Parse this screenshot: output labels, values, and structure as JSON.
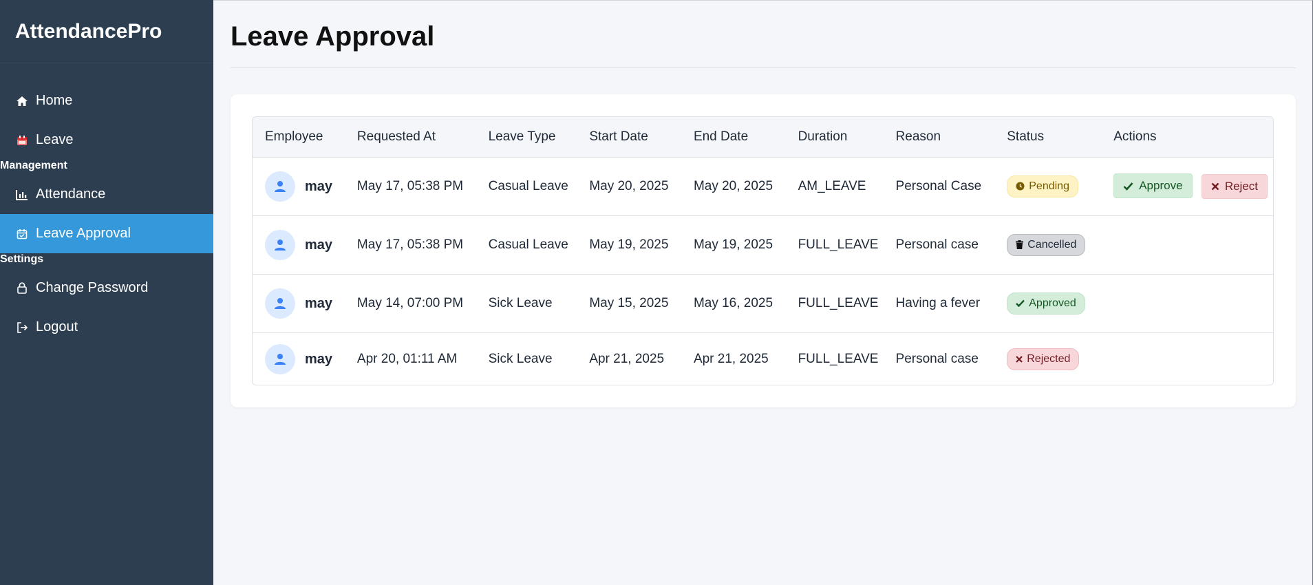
{
  "app": {
    "brand": "AttendancePro"
  },
  "sidebar": {
    "items": [
      {
        "label": "Home",
        "icon": "home-icon"
      },
      {
        "label": "Leave",
        "icon": "calendar-icon"
      },
      {
        "label": "Attendance",
        "icon": "bar-chart-icon"
      },
      {
        "label": "Leave Approval",
        "icon": "calendar-check-icon",
        "active": true
      },
      {
        "label": "Change Password",
        "icon": "lock-icon"
      },
      {
        "label": "Logout",
        "icon": "logout-icon"
      }
    ],
    "sections": {
      "management": "Management",
      "settings": "Settings"
    }
  },
  "page": {
    "title": "Leave Approval"
  },
  "table": {
    "headers": [
      "Employee",
      "Requested At",
      "Leave Type",
      "Start Date",
      "End Date",
      "Duration",
      "Reason",
      "Status",
      "Actions"
    ],
    "rows": [
      {
        "employee": "may",
        "requested_at": "May 17, 05:38 PM",
        "leave_type": "Casual Leave",
        "start_date": "May 20, 2025",
        "end_date": "May 20, 2025",
        "duration": "AM_LEAVE",
        "reason": "Personal Case",
        "status": "Pending"
      },
      {
        "employee": "may",
        "requested_at": "May 17, 05:38 PM",
        "leave_type": "Casual Leave",
        "start_date": "May 19, 2025",
        "end_date": "May 19, 2025",
        "duration": "FULL_LEAVE",
        "reason": "Personal case",
        "status": "Cancelled"
      },
      {
        "employee": "may",
        "requested_at": "May 14, 07:00 PM",
        "leave_type": "Sick Leave",
        "start_date": "May 15, 2025",
        "end_date": "May 16, 2025",
        "duration": "FULL_LEAVE",
        "reason": "Having a fever",
        "status": "Approved"
      },
      {
        "employee": "may",
        "requested_at": "Apr 20, 01:11 AM",
        "leave_type": "Sick Leave",
        "start_date": "Apr 21, 2025",
        "end_date": "Apr 21, 2025",
        "duration": "FULL_LEAVE",
        "reason": "Personal case",
        "status": "Rejected"
      }
    ],
    "actions": {
      "approve": "Approve",
      "reject": "Reject"
    }
  },
  "colors": {
    "sidebar_bg": "#2c3e50",
    "active_item": "#3498db",
    "pending": "#fdf3c4",
    "approved": "#d4edda",
    "rejected": "#f8d7da",
    "cancelled": "#d6d8db"
  }
}
